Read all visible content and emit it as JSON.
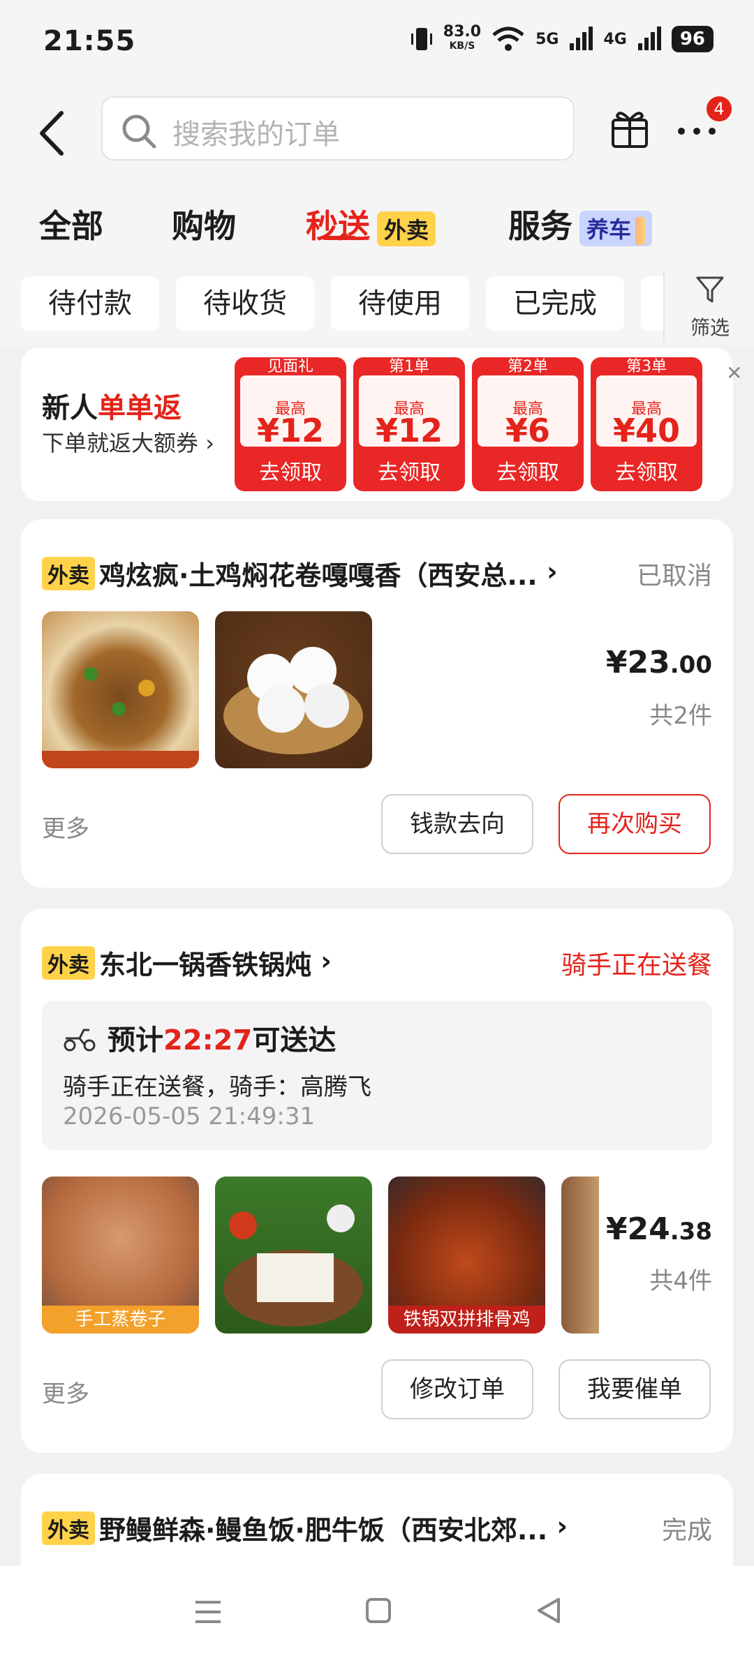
{
  "status": {
    "time": "21:55",
    "speed": "83.0",
    "speed_unit": "KB/S",
    "net1": "5G",
    "net2": "4G",
    "battery": "96"
  },
  "header": {
    "search_placeholder": "搜索我的订单",
    "more_badge": "4"
  },
  "tabs": [
    {
      "label": "全部"
    },
    {
      "label": "购物"
    },
    {
      "label": "秒送",
      "tag": "外卖"
    },
    {
      "label": "服务",
      "tag": "养车"
    }
  ],
  "filters": {
    "chips": [
      "待付款",
      "待收货",
      "待使用",
      "已完成"
    ],
    "filter_label": "筛选"
  },
  "promo": {
    "title_prefix": "新人",
    "title_highlight": "单单返",
    "subtitle": "下单就返大额券",
    "coupons": [
      {
        "head": "见面礼",
        "label": "最高",
        "amount": "¥12",
        "action": "去领取"
      },
      {
        "head": "第1单",
        "label": "最高",
        "amount": "¥12",
        "action": "去领取"
      },
      {
        "head": "第2单",
        "label": "最高",
        "amount": "¥6",
        "action": "去领取"
      },
      {
        "head": "第3单",
        "label": "最高",
        "amount": "¥40",
        "action": "去领取"
      }
    ]
  },
  "orders": [
    {
      "tag": "外卖",
      "store": "鸡炫疯·土鸡焖花卷嘎嘎香（西安总...",
      "state": "已取消",
      "thumbs": [
        "chicken-flatbread",
        "steamed-buns"
      ],
      "price_int": "¥23",
      "price_dec": ".00",
      "count": "共2件",
      "more": "更多",
      "btn1": "钱款去向",
      "btn2": "再次购买"
    },
    {
      "tag": "外卖",
      "store": "东北一锅香铁锅炖",
      "state": "骑手正在送餐",
      "eta_prefix": "预计",
      "eta_time": "22:27",
      "eta_suffix": "可送达",
      "rider_line": "骑手正在送餐，骑手：高腾飞",
      "timestamp": "2026-05-05 21:49:31",
      "thumb_captions": [
        "手工蒸卷子",
        "",
        "铁锅双拼排骨鸡"
      ],
      "price_int": "¥24",
      "price_dec": ".38",
      "count": "共4件",
      "more": "更多",
      "btn1": "修改订单",
      "btn2": "我要催单"
    },
    {
      "tag": "外卖",
      "store": "野鳗鲜森·鳗鱼饭·肥牛饭（西安北郊...",
      "state": "完成"
    }
  ],
  "colors": {
    "accent_red": "#e4231a",
    "tag_yellow": "#ffd24a"
  }
}
